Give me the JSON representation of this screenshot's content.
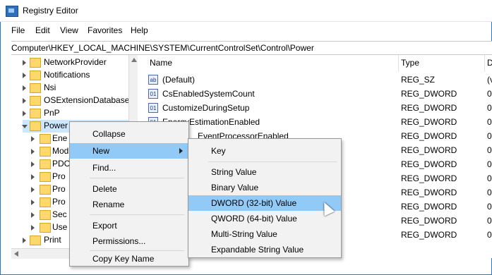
{
  "window": {
    "title": "Registry Editor"
  },
  "menu": [
    "File",
    "Edit",
    "View",
    "Favorites",
    "Help"
  ],
  "address": "Computer\\HKEY_LOCAL_MACHINE\\SYSTEM\\CurrentControlSet\\Control\\Power",
  "tree": {
    "items": [
      {
        "label": "NetworkProvider"
      },
      {
        "label": "Notifications"
      },
      {
        "label": "Nsi"
      },
      {
        "label": "OSExtensionDatabase"
      },
      {
        "label": "PnP"
      },
      {
        "label": "Power"
      }
    ],
    "subitems": [
      "Ene",
      "Mod",
      "PDC",
      "Pro",
      "Pro",
      "Pro",
      "Sec",
      "Use"
    ],
    "last": "Print"
  },
  "list": {
    "headers": {
      "name": "Name",
      "type": "Type",
      "data": "D"
    },
    "rows": [
      {
        "name": "(Default)",
        "type": "REG_SZ",
        "data": "(v",
        "icon": "ab"
      },
      {
        "name": "CsEnabledSystemCount",
        "type": "REG_DWORD",
        "data": "0",
        "icon": "01"
      },
      {
        "name": "CustomizeDuringSetup",
        "type": "REG_DWORD",
        "data": "0",
        "icon": "01"
      },
      {
        "name": "EnergyEstimationEnabled",
        "type": "REG_DWORD",
        "data": "0",
        "icon": "01"
      },
      {
        "name": "EventProcessorEnabled",
        "type": "REG_DWORD",
        "data": "0",
        "icon": "01"
      },
      {
        "name": "",
        "type": "REG_DWORD",
        "data": "0",
        "icon": "01"
      },
      {
        "name": "",
        "type": "REG_DWORD",
        "data": "0",
        "icon": "01"
      },
      {
        "name": "",
        "type": "REG_DWORD",
        "data": "0",
        "icon": "01"
      },
      {
        "name": "",
        "type": "REG_DWORD",
        "data": "0",
        "icon": "01"
      },
      {
        "name": "",
        "type": "REG_DWORD",
        "data": "0",
        "icon": "01"
      },
      {
        "name": "",
        "type": "REG_DWORD",
        "data": "0",
        "icon": "01"
      },
      {
        "name": "",
        "type": "REG_DWORD",
        "data": "0",
        "icon": "01"
      }
    ]
  },
  "context_menu": {
    "items": [
      "Collapse",
      "New",
      "Find...",
      "Delete",
      "Rename",
      "Export",
      "Permissions...",
      "Copy Key Name"
    ]
  },
  "new_submenu": {
    "items": [
      "Key",
      "String Value",
      "Binary Value",
      "DWORD (32-bit) Value",
      "QWORD (64-bit) Value",
      "Multi-String Value",
      "Expandable String Value"
    ]
  },
  "colors": {
    "highlight": "#91c9f7",
    "selection": "#cce8ff",
    "accent": "#2b78c7"
  },
  "icons": {
    "folder": "folder-icon",
    "string_value": "reg-string-icon",
    "dword_value": "reg-binary-icon",
    "cursor": "mouse-pointer-icon"
  }
}
